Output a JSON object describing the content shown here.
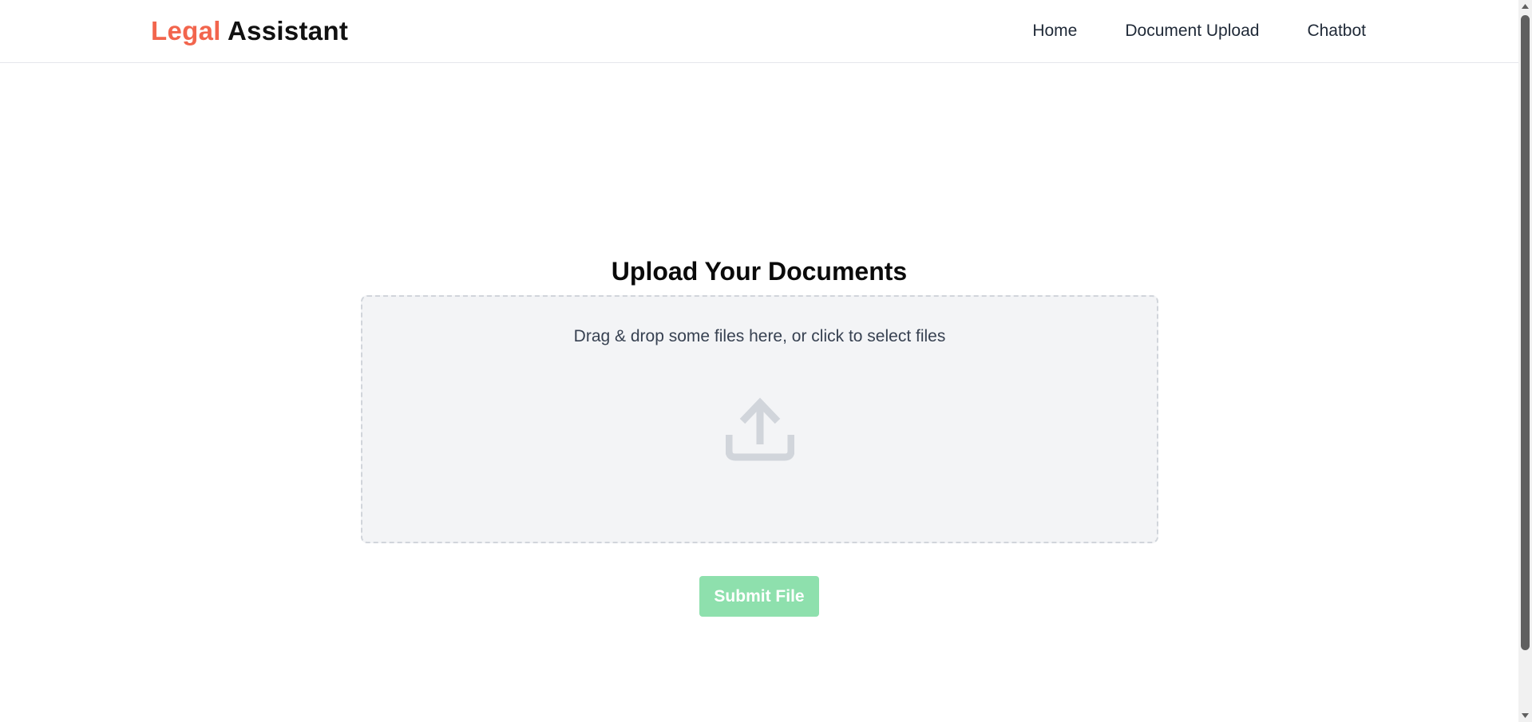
{
  "brand": {
    "accent_text": "Legal",
    "main_text": "Assistant",
    "accent_color": "#f2654d"
  },
  "nav": {
    "items": [
      {
        "label": "Home"
      },
      {
        "label": "Document Upload"
      },
      {
        "label": "Chatbot"
      }
    ]
  },
  "main": {
    "title": "Upload Your Documents",
    "dropzone": {
      "instruction": "Drag & drop some files here, or click to select files",
      "icon": "upload-icon"
    },
    "submit_label": "Submit File",
    "submit_color": "#8ee0ad"
  }
}
